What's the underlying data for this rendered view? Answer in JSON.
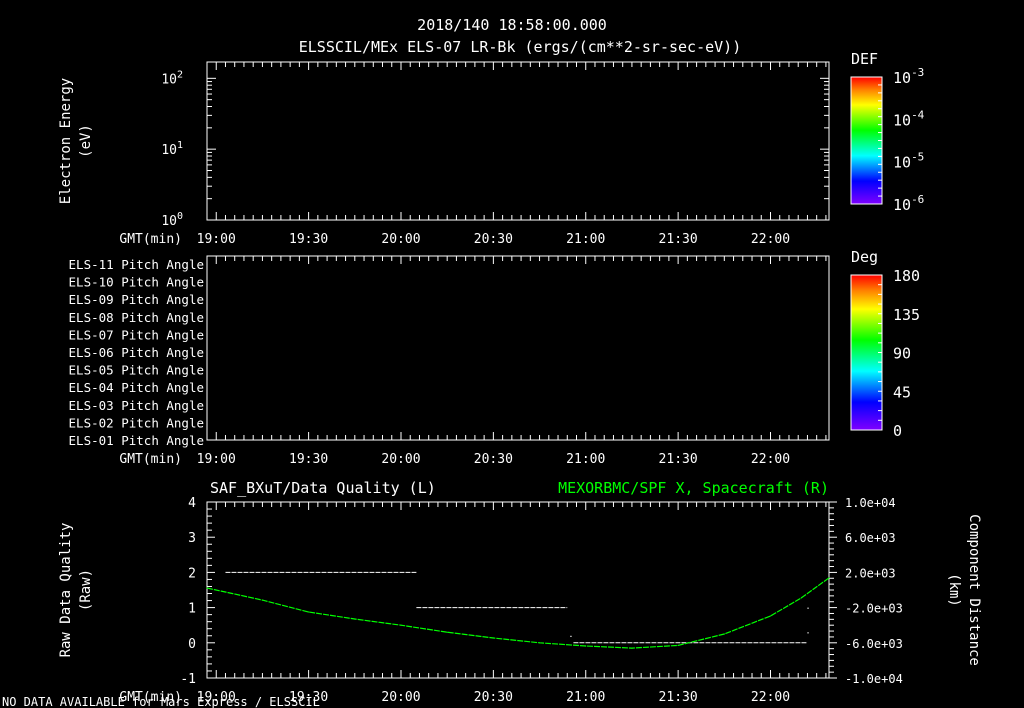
{
  "header": {
    "title": "2018/140 18:58:00.000",
    "subtitle": "ELSSCIL/MEx ELS-07 LR-Bk  (ergs/(cm**2-sr-sec-eV))"
  },
  "footer": "NO DATA AVAILABLE for Mars  Express / ELSSCIL",
  "time_axis": {
    "label": "GMT(min)",
    "xlim": [
      "18:57",
      "22:19"
    ],
    "ticks": [
      "19:00",
      "19:30",
      "20:00",
      "20:30",
      "21:00",
      "21:30",
      "22:00"
    ]
  },
  "chart_data": [
    {
      "type": "heatmap",
      "name": "energy-spectrogram",
      "ylabel": [
        "Electron Energy",
        "(eV)"
      ],
      "yscale": "log",
      "ylim": [
        1,
        170
      ],
      "yticks": [
        {
          "base": "10",
          "exp": "0",
          "value": 1
        },
        {
          "base": "10",
          "exp": "1",
          "value": 10
        },
        {
          "base": "10",
          "exp": "2",
          "value": 100
        }
      ],
      "values": [],
      "colorbar": {
        "title": "DEF",
        "scale": "log",
        "range": [
          1e-06,
          0.001
        ],
        "ticks": [
          {
            "base": "10",
            "exp": "-3"
          },
          {
            "base": "10",
            "exp": "-4"
          },
          {
            "base": "10",
            "exp": "-5"
          },
          {
            "base": "10",
            "exp": "-6"
          }
        ]
      }
    },
    {
      "type": "heatmap",
      "name": "pitch-angle",
      "rows": [
        "ELS-11 Pitch Angle",
        "ELS-10 Pitch Angle",
        "ELS-09 Pitch Angle",
        "ELS-08 Pitch Angle",
        "ELS-07 Pitch Angle",
        "ELS-06 Pitch Angle",
        "ELS-05 Pitch Angle",
        "ELS-04 Pitch Angle",
        "ELS-03 Pitch Angle",
        "ELS-02 Pitch Angle",
        "ELS-01 Pitch Angle"
      ],
      "values": [],
      "colorbar": {
        "title": "Deg",
        "range": [
          0,
          180
        ],
        "ticks": [
          "180",
          "135",
          "90",
          "45",
          "0"
        ]
      }
    },
    {
      "type": "line",
      "left_title": "SAF_BXuT/Data Quality (L)",
      "right_title": "MEXORBMC/SPF X, Spacecraft (R)",
      "right_color": "#00ff00",
      "ylabel_left": [
        "Raw Data Quality",
        "(Raw)"
      ],
      "ylabel_right": [
        "Component Distance",
        "(km)"
      ],
      "ylim_left": [
        -1,
        4
      ],
      "yticks_left": [
        "4",
        "3",
        "2",
        "1",
        "0",
        "-1"
      ],
      "ylim_right": [
        -10000,
        10000
      ],
      "yticks_right": [
        "1.0e+04",
        "6.0e+03",
        "2.0e+03",
        "-2.0e+03",
        "-6.0e+03",
        "-1.0e+04"
      ],
      "series": [
        {
          "axis": "left",
          "color": "#ffffff",
          "style": "dashed-segments",
          "segments": [
            {
              "start": "19:03",
              "end": "20:05",
              "value": 2
            },
            {
              "start": "20:05",
              "end": "20:54",
              "value": 1
            },
            {
              "start": "20:56",
              "end": "22:12",
              "value": 0
            }
          ],
          "points": [
            {
              "t": "20:55",
              "value": 0.2
            },
            {
              "t": "22:12",
              "value": 1
            },
            {
              "t": "22:12",
              "value": 0.3
            }
          ]
        },
        {
          "axis": "right",
          "color": "#00ff00",
          "points": [
            {
              "t": "18:57",
              "value": 230
            },
            {
              "t": "19:15",
              "value": -1150
            },
            {
              "t": "19:30",
              "value": -2500
            },
            {
              "t": "19:45",
              "value": -3300
            },
            {
              "t": "20:00",
              "value": -4000
            },
            {
              "t": "20:15",
              "value": -4800
            },
            {
              "t": "20:30",
              "value": -5450
            },
            {
              "t": "20:45",
              "value": -6000
            },
            {
              "t": "21:00",
              "value": -6360
            },
            {
              "t": "21:15",
              "value": -6600
            },
            {
              "t": "21:30",
              "value": -6300
            },
            {
              "t": "21:45",
              "value": -5000
            },
            {
              "t": "22:00",
              "value": -2950
            },
            {
              "t": "22:10",
              "value": -900
            },
            {
              "t": "22:19",
              "value": 1370
            }
          ]
        }
      ]
    }
  ]
}
